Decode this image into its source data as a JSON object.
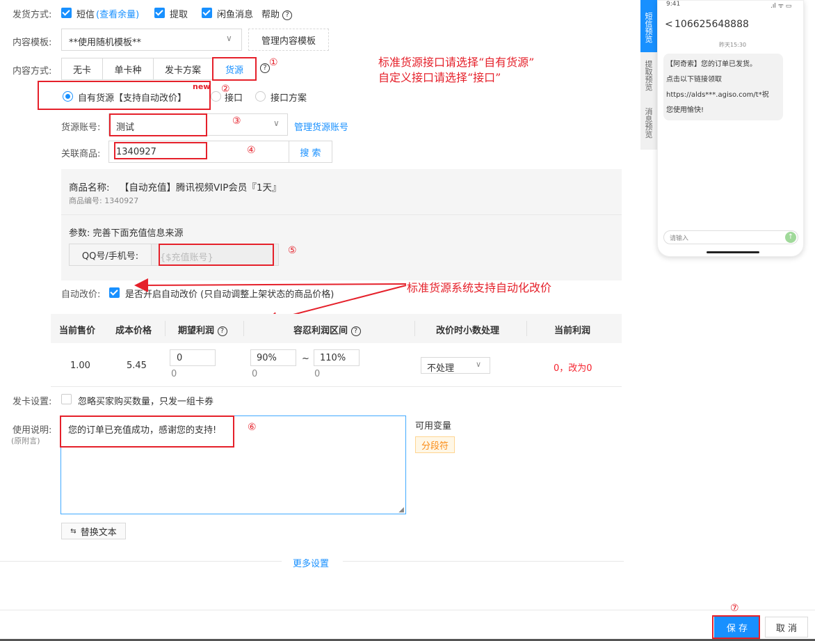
{
  "delivery": {
    "label": "发货方式:",
    "sms": "短信",
    "sms_quota": "(查看余量)",
    "pickup": "提取",
    "xianyu": "闲鱼消息",
    "help": "帮助"
  },
  "template": {
    "label": "内容模板:",
    "value": "**使用随机模板**",
    "manage": "管理内容模板"
  },
  "content_mode": {
    "label": "内容方式:",
    "tabs": [
      "无卡",
      "单卡种",
      "发卡方案",
      "货源"
    ],
    "active_index": 3
  },
  "source": {
    "options": [
      "自有货源【支持自动改价】",
      "接口",
      "接口方案"
    ],
    "new_badge": "new",
    "account_label": "货源账号:",
    "account_value": "测试",
    "manage_account": "管理货源账号",
    "product_label": "关联商品:",
    "product_value": "1340927",
    "search": "搜 索"
  },
  "product": {
    "name_label": "商品名称:",
    "name_value": "【自动充值】腾讯视频VIP会员『1天』",
    "code": "商品编号: 1340927",
    "params_title": "参数: 完善下面充值信息来源",
    "qq_label": "QQ号/手机号:",
    "qq_placeholder": "{$充值账号}"
  },
  "auto_price": {
    "label": "自动改价:",
    "text": "是否开启自动改价 (只自动调整上架状态的商品价格)"
  },
  "price_table": {
    "headers": [
      "当前售价",
      "成本价格",
      "期望利润",
      "容忍利润区间",
      "改价时小数处理",
      "当前利润"
    ],
    "row": {
      "price": "1.00",
      "cost": "5.45",
      "expected": "0",
      "expected_sub": "0",
      "low": "90%",
      "low_sub": "0",
      "tilde": "~",
      "high": "110%",
      "high_sub": "0",
      "decimal": "不处理",
      "profit": "0，改为0"
    }
  },
  "card": {
    "label": "发卡设置:",
    "text": "忽略买家购买数量，只发一组卡券"
  },
  "usage": {
    "label": "使用说明:",
    "sublabel": "(原附言)",
    "text": "您的订单已充值成功，感谢您的支持!",
    "variables_title": "可用变量",
    "variable": "分段符",
    "replace": "替换文本"
  },
  "more": "更多设置",
  "footer": {
    "save": "保 存",
    "cancel": "取 消"
  },
  "annotations": {
    "n1": "①",
    "n2": "②",
    "n3": "③",
    "n4": "④",
    "n5": "⑤",
    "n6": "⑥",
    "n7": "⑦",
    "note_top_1": "标准货源接口请选择“自有货源”",
    "note_top_2": "自定义接口请选择“接口”",
    "note_mid": "标准货源系统支持自动化改价"
  },
  "phone": {
    "time": "9:41",
    "signal": ".ıl ᯤ ▭",
    "number": "106625648888",
    "date": "昨天15:30",
    "message": [
      "【阿奇索】您的订单已发货。",
      "点击以下链接领取",
      "https://alds***.agiso.com/t*祝",
      "您使用愉快!"
    ],
    "input_placeholder": "请输入",
    "tabs": [
      "短信预览",
      "提取预览",
      "消息预览"
    ]
  },
  "colors": {
    "accent": "#1890ff",
    "annotation": "#e5202a",
    "profit": "#f5222d"
  }
}
